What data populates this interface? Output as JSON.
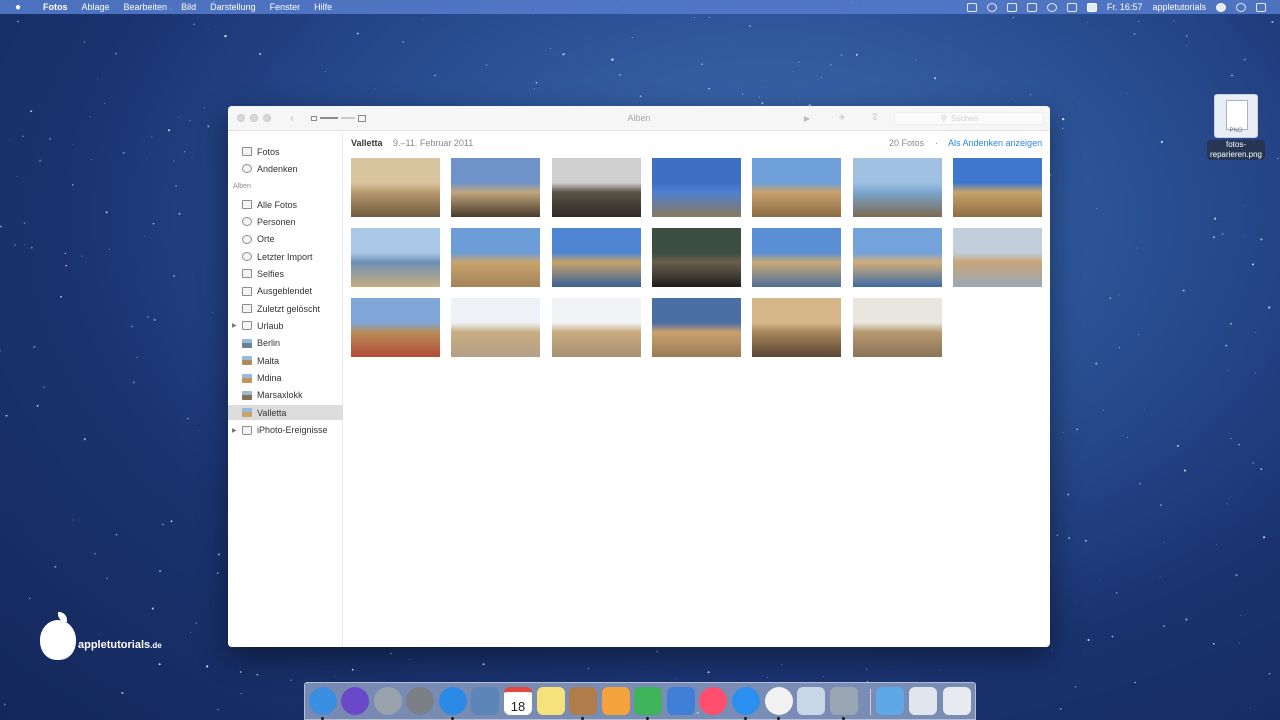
{
  "menubar": {
    "apple_icon": "apple-icon",
    "items": [
      "Fotos",
      "Ablage",
      "Bearbeiten",
      "Bild",
      "Darstellung",
      "Fenster",
      "Hilfe"
    ],
    "clock": "Fr. 16:57",
    "user": "appletutorials"
  },
  "window": {
    "title": "Alben",
    "search_placeholder": "Suchen"
  },
  "sidebar": {
    "top_items": [
      {
        "label": "Fotos",
        "icon": "photos-icon"
      },
      {
        "label": "Andenken",
        "icon": "memories-icon"
      }
    ],
    "section_label": "Alben",
    "album_items": [
      {
        "label": "Alle Fotos",
        "icon": "all-photos-icon"
      },
      {
        "label": "Personen",
        "icon": "person-icon"
      },
      {
        "label": "Orte",
        "icon": "pin-icon"
      },
      {
        "label": "Letzter Import",
        "icon": "clock-icon"
      },
      {
        "label": "Selfies",
        "icon": "camera-icon"
      },
      {
        "label": "Ausgeblendet",
        "icon": "hidden-icon"
      },
      {
        "label": "Zuletzt gelöscht",
        "icon": "trash-icon"
      },
      {
        "label": "Urlaub",
        "icon": "folder-icon"
      },
      {
        "label": "Berlin",
        "icon": "album-thumb-icon"
      },
      {
        "label": "Malta",
        "icon": "album-thumb-icon"
      },
      {
        "label": "Mdina",
        "icon": "album-thumb-icon"
      },
      {
        "label": "Marsaxlokk",
        "icon": "album-thumb-icon"
      },
      {
        "label": "Valletta",
        "icon": "album-thumb-icon"
      },
      {
        "label": "iPhoto-Ereignisse",
        "icon": "folder-icon"
      }
    ]
  },
  "album": {
    "title": "Valletta",
    "date_range": "9.–11. Februar 2011",
    "count": "20 Fotos",
    "separator": "·",
    "memories_link": "Als Andenken anzeigen"
  },
  "desktop_file": {
    "label_line1": "fotos-",
    "label_line2": "reparieren.png",
    "type_tag": "PNG"
  },
  "logo": {
    "text": "appletutorials",
    "suffix": ".de"
  },
  "dock_icons": [
    "finder-icon",
    "siri-icon",
    "launchpad-icon",
    "system-preferences-icon",
    "safari-icon",
    "preview-icon",
    "calendar-icon",
    "notes-icon",
    "contacts-icon",
    "pages-icon",
    "numbers-icon",
    "keynote-icon",
    "itunes-icon",
    "app-store-icon",
    "photos-app-icon",
    "photo-slideshow-icon",
    "image-capture-icon",
    "downloads-folder-icon",
    "documents-folder-icon",
    "trash-dock-icon"
  ],
  "calendar_day": "18",
  "colors": {
    "accent_link": "#2b86e6",
    "selection": "#dcdcdc"
  }
}
